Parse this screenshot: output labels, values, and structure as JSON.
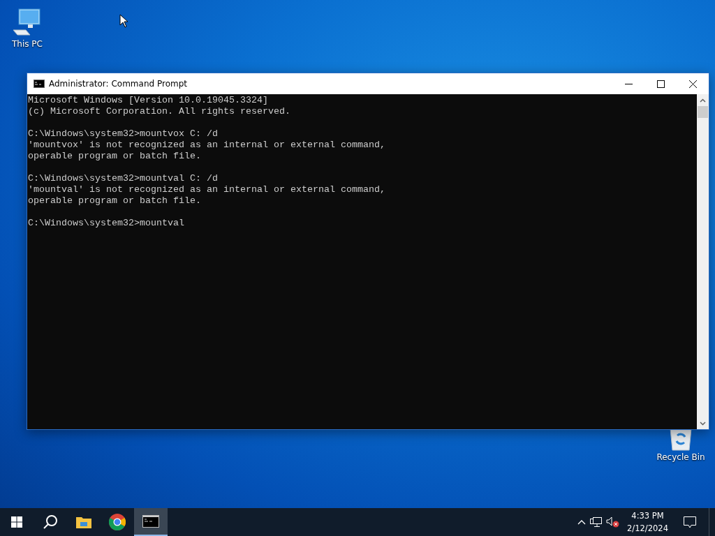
{
  "desktop_icons": [
    {
      "kind": "computer",
      "label": "This PC"
    },
    {
      "kind": "recycle",
      "label": "Recycle Bin"
    }
  ],
  "window": {
    "title": "Administrator: Command Prompt",
    "console": [
      [
        "Microsoft Windows [Version 10.0.19045.3324]",
        "(c) Microsoft Corporation. All rights reserved."
      ],
      [
        "C:\\Windows\\system32>mountvox C: /d",
        "'mountvox' is not recognized as an internal or external command,",
        "operable program or batch file."
      ],
      [
        "C:\\Windows\\system32>mountval C: /d",
        "'mountval' is not recognized as an internal or external command,",
        "operable program or batch file."
      ],
      [
        "C:\\Windows\\system32>mountval"
      ]
    ]
  },
  "taskbar": {
    "apps": [
      {
        "kind": "start",
        "selected": false
      },
      {
        "kind": "search",
        "selected": false
      },
      {
        "kind": "explorer",
        "selected": false
      },
      {
        "kind": "chrome",
        "selected": false
      },
      {
        "kind": "cmd",
        "selected": true
      }
    ],
    "clock": {
      "time": "4:33 PM",
      "date": "2/12/2024"
    }
  }
}
